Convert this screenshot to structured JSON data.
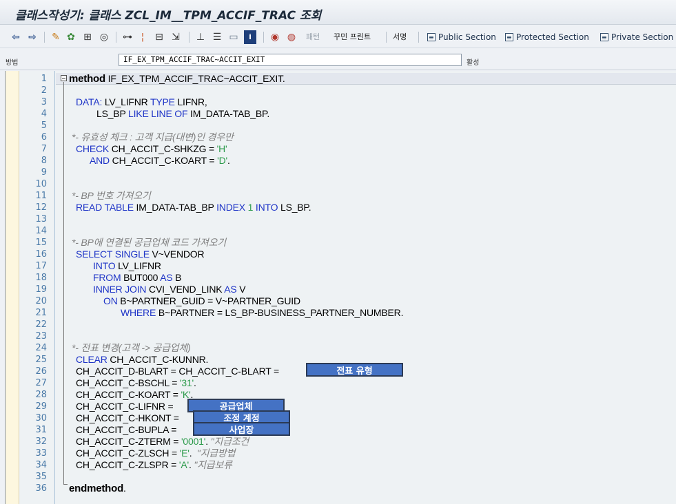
{
  "window": {
    "title": "클래스작성기: 클래스 ZCL_IM__TPM_ACCIF_TRAC 조회"
  },
  "toolbar": {
    "back_icon": "arrow-left-icon",
    "forward_icon": "arrow-right-icon",
    "pattern_label": "패턴",
    "pretty_print_label": "꾸민 프린트",
    "signature_label": "서명",
    "public_section_label": "Public Section",
    "protected_section_label": "Protected Section",
    "private_section_label": "Private Section"
  },
  "method_bar": {
    "label": "방법",
    "method_name": "IF_EX_TPM_ACCIF_TRAC~ACCIT_EXIT",
    "status": "활성"
  },
  "code": {
    "lines": [
      {
        "n": "1",
        "parts": [
          [
            "strong",
            "method"
          ],
          [
            "t",
            " IF_EX_TPM_ACCIF_TRAC~ACCIT_EXIT."
          ]
        ],
        "indent": 0
      },
      {
        "n": "2",
        "parts": [],
        "indent": 0
      },
      {
        "n": "3",
        "parts": [
          [
            "kw",
            "DATA:"
          ],
          [
            "t",
            " LV_LIFNR "
          ],
          [
            "kw",
            "TYPE"
          ],
          [
            "t",
            " LIFNR,"
          ]
        ],
        "indent": 10
      },
      {
        "n": "4",
        "parts": [
          [
            "t",
            "LS_BP "
          ],
          [
            "kw",
            "LIKE LINE OF"
          ],
          [
            "t",
            " IM_DATA-TAB_BP."
          ]
        ],
        "indent": 40
      },
      {
        "n": "5",
        "parts": [],
        "indent": 0
      },
      {
        "n": "6",
        "parts": [
          [
            "cm",
            "*- 유효성 체크 : 고객 지급(대변)인 경우만"
          ]
        ],
        "indent": 4
      },
      {
        "n": "7",
        "parts": [
          [
            "kw",
            "CHECK"
          ],
          [
            "t",
            " CH_ACCIT_C-SHKZG = "
          ],
          [
            "lit",
            "'H'"
          ]
        ],
        "indent": 10
      },
      {
        "n": "8",
        "parts": [
          [
            "kw",
            "AND"
          ],
          [
            "t",
            " CH_ACCIT_C-KOART = "
          ],
          [
            "lit",
            "'D'"
          ],
          [
            "t",
            "."
          ]
        ],
        "indent": 30
      },
      {
        "n": "9",
        "parts": [],
        "indent": 0
      },
      {
        "n": "10",
        "parts": [],
        "indent": 0
      },
      {
        "n": "11",
        "parts": [
          [
            "cm",
            "*- BP 번호 가져오기"
          ]
        ],
        "indent": 4
      },
      {
        "n": "12",
        "parts": [
          [
            "kw",
            "READ TABLE"
          ],
          [
            "t",
            " IM_DATA-TAB_BP "
          ],
          [
            "kw",
            "INDEX"
          ],
          [
            "t",
            " "
          ],
          [
            "lit",
            "1"
          ],
          [
            "t",
            " "
          ],
          [
            "kw",
            "INTO"
          ],
          [
            "t",
            " LS_BP."
          ]
        ],
        "indent": 10
      },
      {
        "n": "13",
        "parts": [],
        "indent": 0
      },
      {
        "n": "14",
        "parts": [],
        "indent": 0
      },
      {
        "n": "15",
        "parts": [
          [
            "cm",
            "*- BP에 연결된 공급업체 코드 가져오기"
          ]
        ],
        "indent": 4
      },
      {
        "n": "16",
        "parts": [
          [
            "kw",
            "SELECT SINGLE"
          ],
          [
            "t",
            " V~VENDOR"
          ]
        ],
        "indent": 10
      },
      {
        "n": "17",
        "parts": [
          [
            "kw",
            "INTO"
          ],
          [
            "t",
            " LV_LIFNR"
          ]
        ],
        "indent": 35
      },
      {
        "n": "18",
        "parts": [
          [
            "kw",
            "FROM"
          ],
          [
            "t",
            " BUT000 "
          ],
          [
            "kw",
            "AS"
          ],
          [
            "t",
            " B"
          ]
        ],
        "indent": 35
      },
      {
        "n": "19",
        "parts": [
          [
            "kw",
            "INNER JOIN"
          ],
          [
            "t",
            " CVI_VEND_LINK "
          ],
          [
            "kw",
            "AS"
          ],
          [
            "t",
            " V"
          ]
        ],
        "indent": 35
      },
      {
        "n": "20",
        "parts": [
          [
            "kw",
            "ON"
          ],
          [
            "t",
            " B~PARTNER_GUID = V~PARTNER_GUID"
          ]
        ],
        "indent": 50
      },
      {
        "n": "21",
        "parts": [
          [
            "kw",
            "WHERE"
          ],
          [
            "t",
            " B~PARTNER = LS_BP-BUSINESS_PARTNER_NUMBER."
          ]
        ],
        "indent": 75
      },
      {
        "n": "22",
        "parts": [],
        "indent": 0
      },
      {
        "n": "23",
        "parts": [],
        "indent": 0
      },
      {
        "n": "24",
        "parts": [
          [
            "cm",
            "*- 전표 변경(고객 -> 공급업체)"
          ]
        ],
        "indent": 4
      },
      {
        "n": "25",
        "parts": [
          [
            "kw",
            "CLEAR"
          ],
          [
            "t",
            " CH_ACCIT_C-KUNNR."
          ]
        ],
        "indent": 10
      },
      {
        "n": "26",
        "parts": [
          [
            "t",
            "CH_ACCIT_D-BLART = CH_ACCIT_C-BLART ="
          ]
        ],
        "indent": 10
      },
      {
        "n": "27",
        "parts": [
          [
            "t",
            "CH_ACCIT_C-BSCHL = "
          ],
          [
            "lit",
            "'31'"
          ],
          [
            "t",
            "."
          ]
        ],
        "indent": 10
      },
      {
        "n": "28",
        "parts": [
          [
            "t",
            "CH_ACCIT_C-KOART = "
          ],
          [
            "lit",
            "'K'"
          ],
          [
            "t",
            "."
          ]
        ],
        "indent": 10
      },
      {
        "n": "29",
        "parts": [
          [
            "t",
            "CH_ACCIT_C-LIFNR ="
          ]
        ],
        "indent": 10
      },
      {
        "n": "30",
        "parts": [
          [
            "t",
            "CH_ACCIT_C-HKONT ="
          ]
        ],
        "indent": 10
      },
      {
        "n": "31",
        "parts": [
          [
            "t",
            "CH_ACCIT_C-BUPLA ="
          ]
        ],
        "indent": 10
      },
      {
        "n": "32",
        "parts": [
          [
            "t",
            "CH_ACCIT_C-ZTERM = "
          ],
          [
            "lit",
            "'0001'"
          ],
          [
            "t",
            ". "
          ],
          [
            "cm",
            "\"지급조건"
          ]
        ],
        "indent": 10
      },
      {
        "n": "33",
        "parts": [
          [
            "t",
            "CH_ACCIT_C-ZLSCH = "
          ],
          [
            "lit",
            "'E'"
          ],
          [
            "t",
            ".  "
          ],
          [
            "cm",
            "\"지급방법"
          ]
        ],
        "indent": 10
      },
      {
        "n": "34",
        "parts": [
          [
            "t",
            "CH_ACCIT_C-ZLSPR = "
          ],
          [
            "lit",
            "'A'"
          ],
          [
            "t",
            ". "
          ],
          [
            "cm",
            "\"지급보류"
          ]
        ],
        "indent": 10
      },
      {
        "n": "35",
        "parts": [],
        "indent": 0
      },
      {
        "n": "36",
        "parts": [
          [
            "strong",
            "endmethod"
          ],
          [
            "t",
            "."
          ]
        ],
        "indent": 0
      }
    ],
    "highlights": {
      "document_type": "전표 유형",
      "vendor": "공급업체",
      "adjustment_account": "조정 계정",
      "business_place": "사업장"
    }
  },
  "colors": {
    "keyword": "#1f35c7",
    "literal": "#2b9a4a",
    "comment": "#808080",
    "highlight_box": "#4472c4",
    "line_number": "#4a7aa8"
  }
}
